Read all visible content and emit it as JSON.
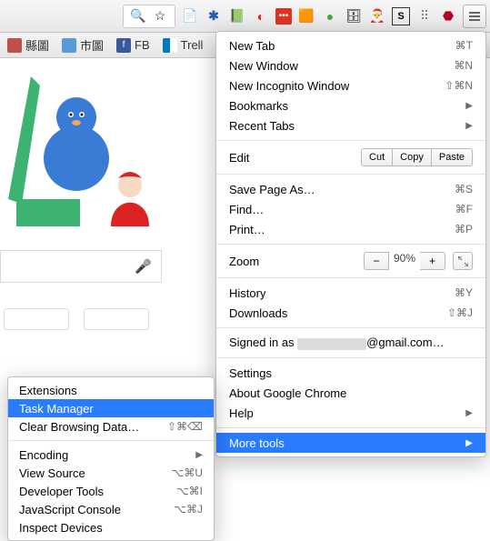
{
  "toolbar": {
    "extensions": [
      "gesture",
      "x-blue",
      "books",
      "trend",
      "lastpass",
      "box",
      "disc",
      "archive",
      "santa",
      "stylebot",
      "grid",
      "ublock"
    ]
  },
  "bookmarks": [
    {
      "label": "縣圖"
    },
    {
      "label": "市圖"
    },
    {
      "label": "FB"
    },
    {
      "label": "Trell"
    }
  ],
  "search": {
    "mic": "🎤"
  },
  "menu": {
    "new_tab": {
      "label": "New Tab",
      "shortcut": "⌘T"
    },
    "new_window": {
      "label": "New Window",
      "shortcut": "⌘N"
    },
    "new_incognito": {
      "label": "New Incognito Window",
      "shortcut": "⇧⌘N"
    },
    "bookmarks": {
      "label": "Bookmarks"
    },
    "recent_tabs": {
      "label": "Recent Tabs"
    },
    "edit": {
      "label": "Edit",
      "cut": "Cut",
      "copy": "Copy",
      "paste": "Paste"
    },
    "save_as": {
      "label": "Save Page As…",
      "shortcut": "⌘S"
    },
    "find": {
      "label": "Find…",
      "shortcut": "⌘F"
    },
    "print": {
      "label": "Print…",
      "shortcut": "⌘P"
    },
    "zoom": {
      "label": "Zoom",
      "value": "90%"
    },
    "history": {
      "label": "History",
      "shortcut": "⌘Y"
    },
    "downloads": {
      "label": "Downloads",
      "shortcut": "⇧⌘J"
    },
    "signed_in": {
      "prefix": "Signed in as ",
      "suffix": "@gmail.com…"
    },
    "settings": {
      "label": "Settings"
    },
    "about": {
      "label": "About Google Chrome"
    },
    "help": {
      "label": "Help"
    },
    "more_tools": {
      "label": "More tools"
    }
  },
  "submenu": {
    "extensions": {
      "label": "Extensions"
    },
    "task_manager": {
      "label": "Task Manager"
    },
    "clear_browsing": {
      "label": "Clear Browsing Data…",
      "shortcut": "⇧⌘⌫"
    },
    "encoding": {
      "label": "Encoding"
    },
    "view_source": {
      "label": "View Source",
      "shortcut": "⌥⌘U"
    },
    "dev_tools": {
      "label": "Developer Tools",
      "shortcut": "⌥⌘I"
    },
    "js_console": {
      "label": "JavaScript Console",
      "shortcut": "⌥⌘J"
    },
    "inspect_devices": {
      "label": "Inspect Devices"
    }
  }
}
